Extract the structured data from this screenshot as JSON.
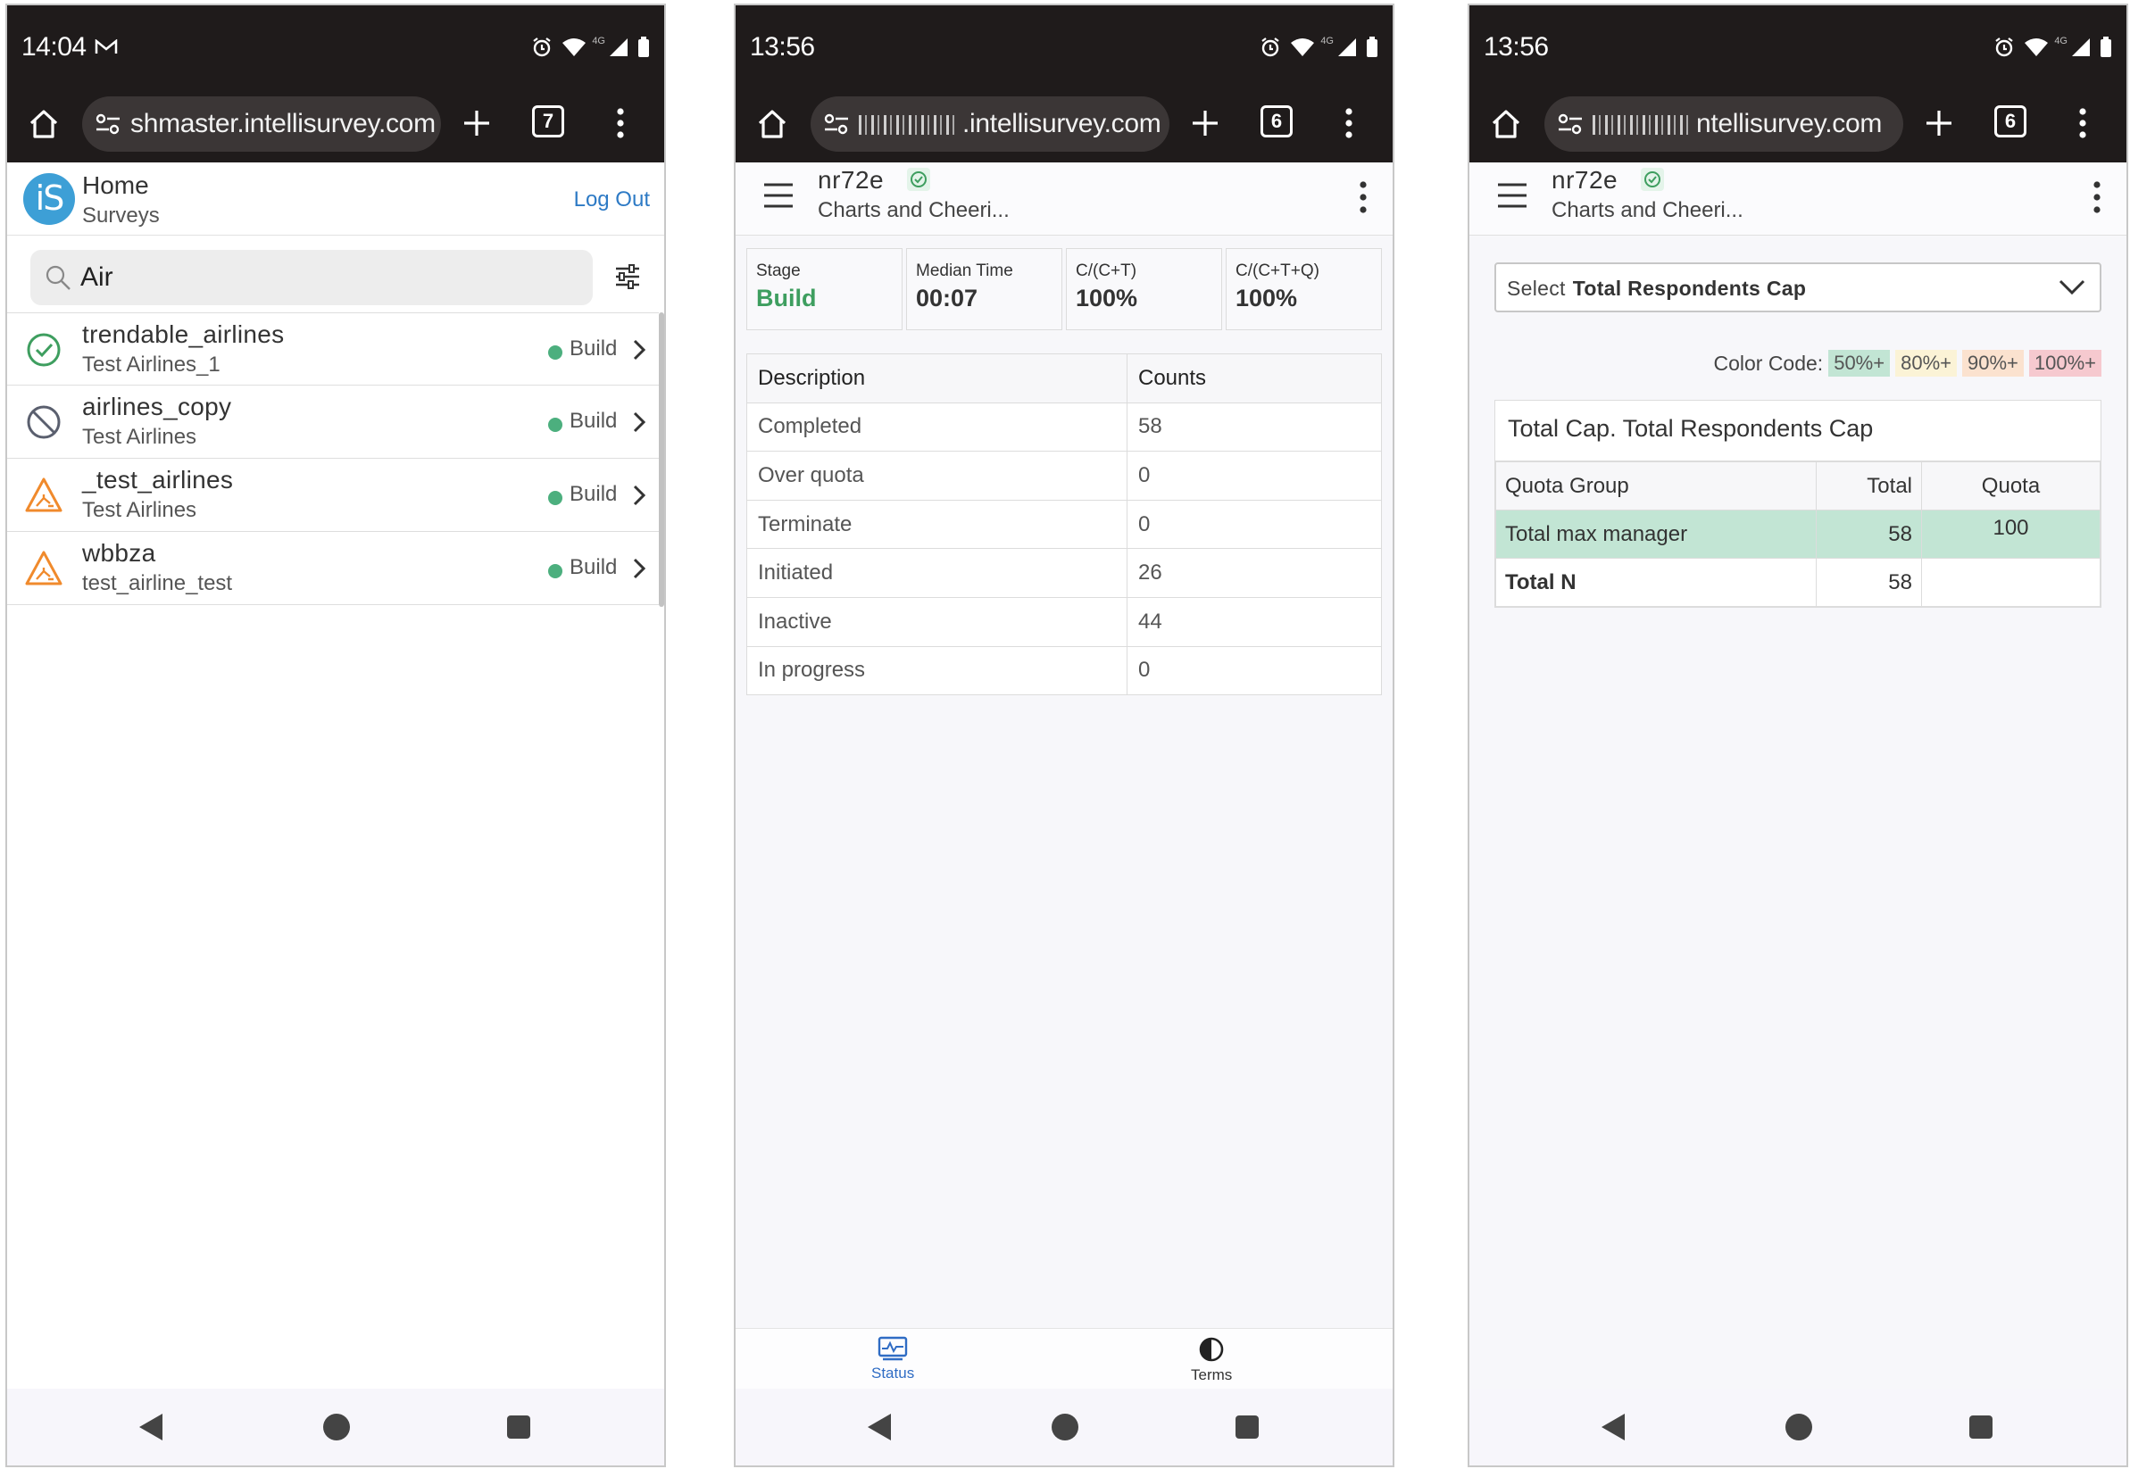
{
  "phones": [
    {
      "status": {
        "time": "14:04",
        "network": "4G"
      },
      "browser": {
        "url": "shmaster.intellisurvey.com",
        "url_blurred": false,
        "tab_count": "7"
      },
      "header": {
        "logo": "iS",
        "title": "Home",
        "subtitle": "Surveys",
        "logout": "Log Out"
      },
      "search": {
        "value": "Air"
      },
      "surveys": [
        {
          "name": "trendable_airlines",
          "subtitle": "Test Airlines_1",
          "stage": "Build",
          "icon": "check-circle-icon"
        },
        {
          "name": "airlines_copy",
          "subtitle": "Test Airlines",
          "stage": "Build",
          "icon": "blocked-icon"
        },
        {
          "name": "_test_airlines",
          "subtitle": "Test Airlines",
          "stage": "Build",
          "icon": "construction-warning-icon"
        },
        {
          "name": "wbbza",
          "subtitle": "test_airline_test",
          "stage": "Build",
          "icon": "construction-warning-icon"
        }
      ]
    },
    {
      "status": {
        "time": "13:56",
        "network": "4G"
      },
      "browser": {
        "url": ".intellisurvey.com",
        "url_blurred": true,
        "tab_count": "6"
      },
      "survey": {
        "code": "nr72e",
        "name": "Charts and Cheeri..."
      },
      "stats": [
        {
          "label": "Stage",
          "value": "Build"
        },
        {
          "label": "Median Time",
          "value": "00:07"
        },
        {
          "label": "C/(C+T)",
          "value": "100%"
        },
        {
          "label": "C/(C+T+Q)",
          "value": "100%"
        }
      ],
      "counts_table": {
        "headers": [
          "Description",
          "Counts"
        ],
        "rows": [
          [
            "Completed",
            "58"
          ],
          [
            "Over quota",
            "0"
          ],
          [
            "Terminate",
            "0"
          ],
          [
            "Initiated",
            "26"
          ],
          [
            "Inactive",
            "44"
          ],
          [
            "In progress",
            "0"
          ]
        ]
      },
      "bottom_tabs": [
        {
          "label": "Status",
          "icon": "status-chart-icon",
          "active": true
        },
        {
          "label": "Terms",
          "icon": "contrast-icon",
          "active": false
        }
      ]
    },
    {
      "status": {
        "time": "13:56",
        "network": "4G"
      },
      "browser": {
        "url": "ntellisurvey.com",
        "url_blurred": true,
        "tab_count": "6"
      },
      "survey": {
        "code": "nr72e",
        "name": "Charts and Cheeri..."
      },
      "select": {
        "label": "Select",
        "value": "Total Respondents Cap"
      },
      "color_code": {
        "label": "Color Code:",
        "chips": [
          {
            "text": "50%+",
            "color": "#c2e5d4"
          },
          {
            "text": "80%+",
            "color": "#fbf3d6"
          },
          {
            "text": "90%+",
            "color": "#fbe2cf"
          },
          {
            "text": "100%+",
            "color": "#f6c9cf"
          }
        ]
      },
      "quota_card": {
        "title": "Total Cap. Total Respondents Cap",
        "headers": [
          "Quota Group",
          "Total",
          "Quota"
        ],
        "rows": [
          {
            "group": "Total max manager",
            "total": "58",
            "quota": "100"
          },
          {
            "group": "Total N",
            "total": "58",
            "quota": ""
          }
        ]
      }
    }
  ],
  "colors": {
    "chrome_bg": "#1f1b1b",
    "accent_blue": "#2d7ac5",
    "build_green": "#3e9e5f",
    "warning_orange": "#f08a2c"
  }
}
